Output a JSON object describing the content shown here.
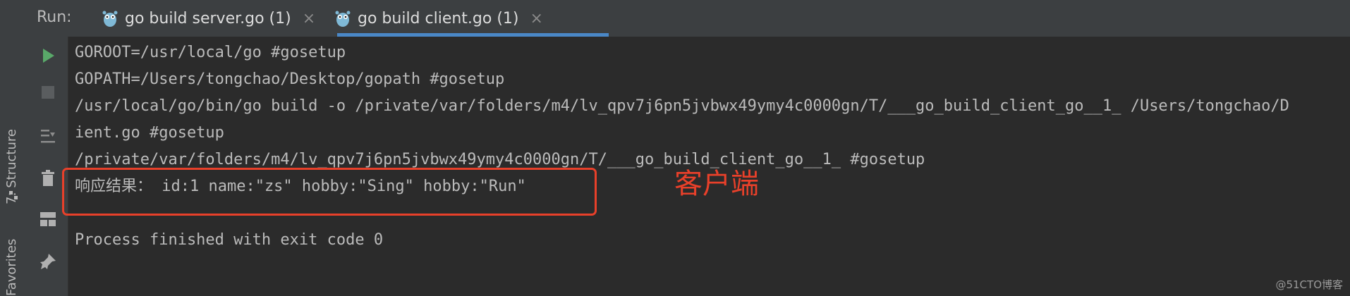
{
  "side_strip": {
    "structure_label": "7: Structure",
    "favorites_label": "Favorites"
  },
  "run_panel": {
    "title": "Run:",
    "tabs": [
      {
        "label": "go build server.go (1)",
        "close": "×",
        "active": false
      },
      {
        "label": "go build client.go (1)",
        "close": "×",
        "active": true
      }
    ]
  },
  "icons": {
    "run": "run-icon",
    "stop": "stop-icon",
    "scroll_end": "scroll-to-end-icon",
    "delete": "trash-icon",
    "layout": "layout-icon",
    "pin": "pin-icon",
    "gopher": "gopher-icon"
  },
  "console": {
    "lines": [
      "GOROOT=/usr/local/go #gosetup",
      "GOPATH=/Users/tongchao/Desktop/gopath #gosetup",
      "/usr/local/go/bin/go build -o /private/var/folders/m4/lv_qpv7j6pn5jvbwx49ymy4c0000gn/T/___go_build_client_go__1_ /Users/tongchao/D",
      "ient.go #gosetup",
      "/private/var/folders/m4/lv_qpv7j6pn5jvbwx49ymy4c0000gn/T/___go_build_client_go__1_ #gosetup",
      "响应结果： id:1 name:\"zs\" hobby:\"Sing\" hobby:\"Run\"",
      "",
      "Process finished with exit code 0"
    ]
  },
  "annotation": {
    "text": "客户端",
    "color": "#e8402a"
  },
  "watermark": "@51CTO博客",
  "colors": {
    "background": "#2b2b2b",
    "panel": "#3c3f41",
    "text": "#bbbbbb",
    "accent": "#4a88c7",
    "run_green": "#59a869"
  }
}
